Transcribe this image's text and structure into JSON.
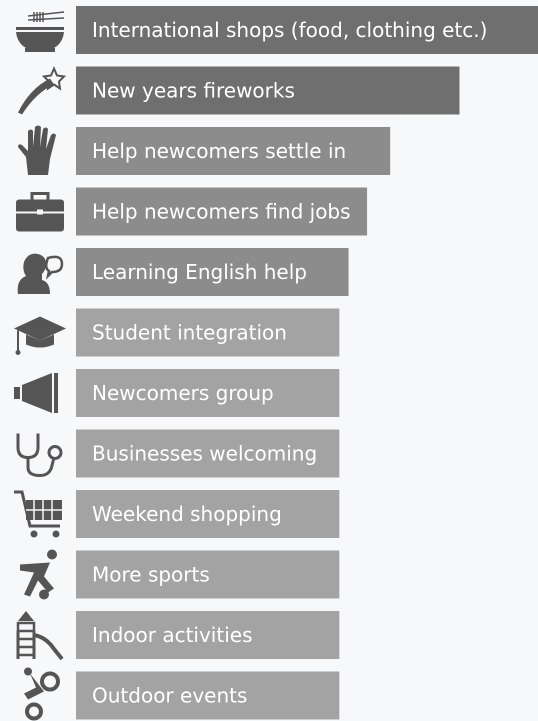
{
  "chart_data": {
    "type": "bar",
    "orientation": "horizontal",
    "categories": [
      "International shops (food, clothing etc.)",
      "New years fireworks",
      "Help newcomers settle in",
      "Help newcomers find jobs",
      "Learning English help",
      "Student integration",
      "Newcomers group",
      "Businesses welcoming",
      "Weekend shopping",
      "More sports",
      "Indoor activities",
      "Outdoor events"
    ],
    "values": [
      100,
      83,
      68,
      63,
      59,
      57,
      57,
      57,
      57,
      57,
      57,
      57
    ],
    "icons": [
      "noodle-bowl-icon",
      "shooting-star-icon",
      "hand-icon",
      "briefcase-icon",
      "speaking-head-icon",
      "graduation-cap-icon",
      "megaphone-icon",
      "stethoscope-icon",
      "shopping-cart-icon",
      "soccer-player-icon",
      "playground-slide-icon",
      "cyclist-icon"
    ],
    "bar_colors": [
      "#6f6f6f",
      "#6f6f6f",
      "#8c8c8c",
      "#8c8c8c",
      "#8c8c8c",
      "#a3a3a3",
      "#a3a3a3",
      "#a3a3a3",
      "#a3a3a3",
      "#a3a3a3",
      "#a3a3a3",
      "#a3a3a3"
    ],
    "icon_color": "#555555",
    "xlim": [
      0,
      100
    ]
  }
}
